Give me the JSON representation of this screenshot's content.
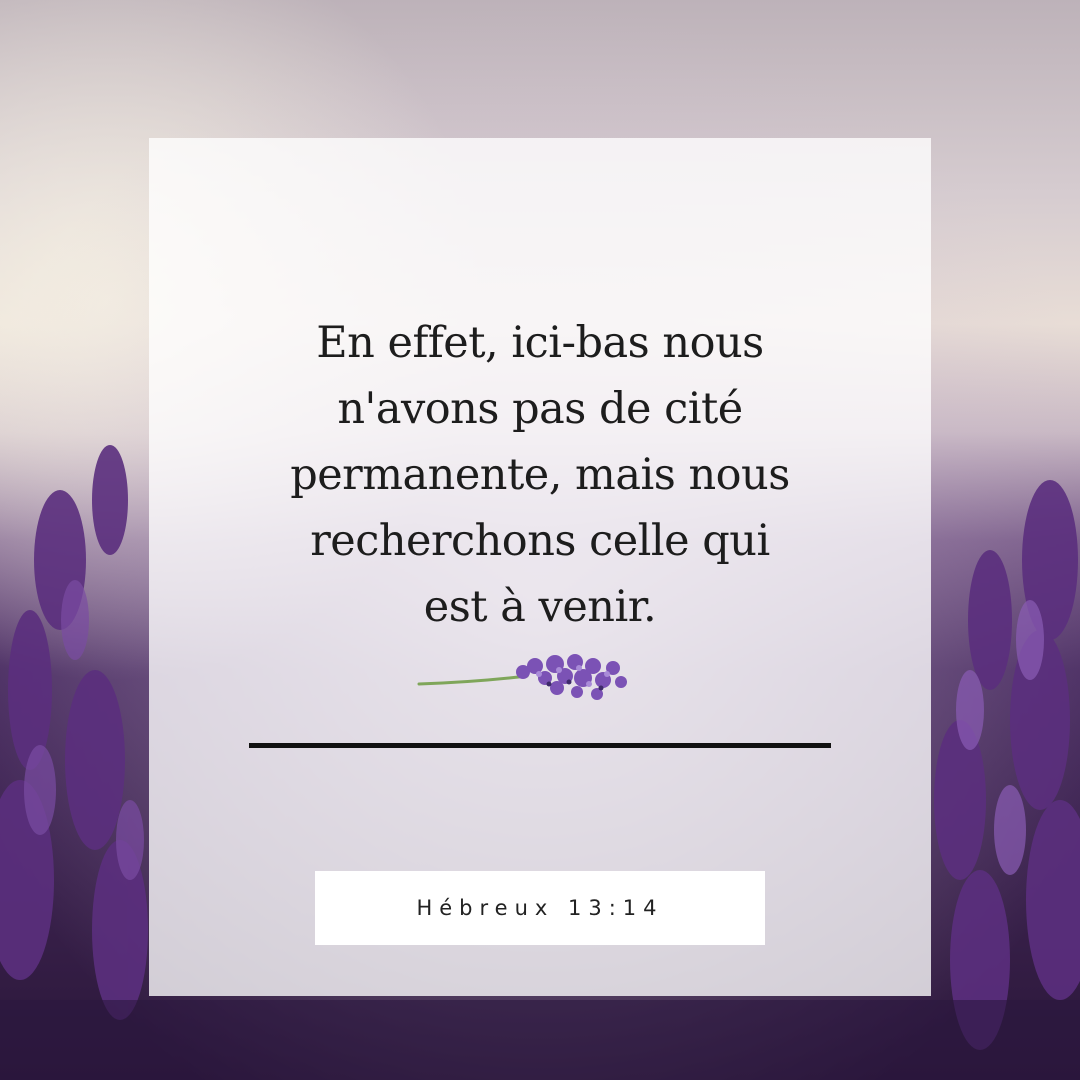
{
  "verse": {
    "lines": [
      "En effet, ici-bas nous",
      "n'avons pas de cité",
      "permanente, mais nous",
      "recherchons celle qui",
      "est à venir."
    ]
  },
  "reference": {
    "label": "Hébreux 13:14"
  },
  "colors": {
    "sky": "#d8d0d6",
    "lavender": "#6a3f8e",
    "lavender_dark": "#3a1f52",
    "card": "#ffffff",
    "text": "#1d1d1d",
    "divider": "#111111"
  },
  "icons": {
    "sprig": "lavender-sprig-icon"
  }
}
